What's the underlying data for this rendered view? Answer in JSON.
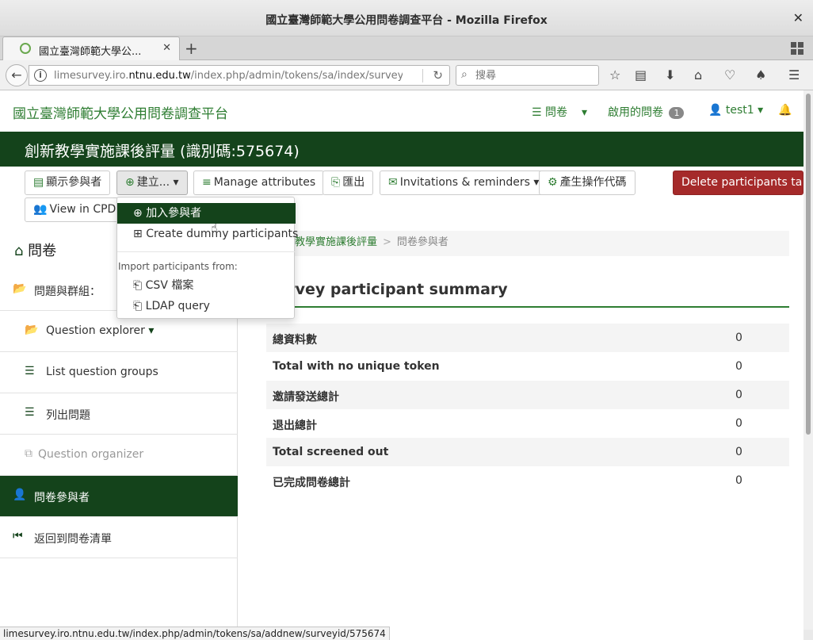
{
  "window": {
    "title": "國立臺灣師範大學公用問卷調查平台 - Mozilla Firefox",
    "close": "✕"
  },
  "tab": {
    "label": "國立臺灣師範大學公...",
    "close": "✕",
    "new": "+"
  },
  "address": {
    "url_prefix": "limesurvey.iro.",
    "url_domain": "ntnu.edu.tw",
    "url_rest": "/index.php/admin/tokens/sa/index/surveyid",
    "search_placeholder": "搜尋"
  },
  "header": {
    "site_title": "國立臺灣師範大學公用問卷調查平台",
    "surveys": "問卷",
    "active_surveys": "啟用的問卷",
    "active_count": "1",
    "user": "test1"
  },
  "survey": {
    "title": "創新教學實施課後評量 (識別碼:575674)"
  },
  "toolbar": {
    "display_participants": "顯示參與者",
    "create": "建立...",
    "manage_attributes": "Manage attributes",
    "export": "匯出",
    "invitations": "Invitations & reminders",
    "generate_tokens": "產生操作代碼",
    "delete_table": "Delete participants table",
    "view_cpdb": "View in CPDB"
  },
  "create_menu": {
    "add_participant": "加入參與者",
    "create_dummy": "Create dummy participants",
    "import_header": "Import participants from:",
    "csv": "CSV 檔案",
    "ldap": "LDAP query"
  },
  "sidebar": {
    "heading": "問卷",
    "items": [
      {
        "label": "問題與群組："
      },
      {
        "label": "Question explorer"
      },
      {
        "label": "List question groups"
      },
      {
        "label": "列出問題"
      },
      {
        "label": "Question organizer"
      },
      {
        "label": "問卷參與者"
      },
      {
        "label": "返回到問卷清單"
      }
    ]
  },
  "breadcrumb": {
    "survey": "創新教學實施課後評量",
    "current": "問卷參與者"
  },
  "summary": {
    "title": "Survey participant summary",
    "rows": [
      {
        "label": "總資料數",
        "value": "0"
      },
      {
        "label": "Total with no unique token",
        "value": "0"
      },
      {
        "label": "邀請發送總計",
        "value": "0"
      },
      {
        "label": "退出總計",
        "value": "0"
      },
      {
        "label": "Total screened out",
        "value": "0"
      },
      {
        "label": "已完成問卷總計",
        "value": "0"
      }
    ]
  },
  "status_url": "limesurvey.iro.ntnu.edu.tw/index.php/admin/tokens/sa/addnew/surveyid/575674",
  "colors": {
    "brand_green": "#14431b",
    "link_green": "#2e7d32",
    "danger": "#a52a2a"
  }
}
